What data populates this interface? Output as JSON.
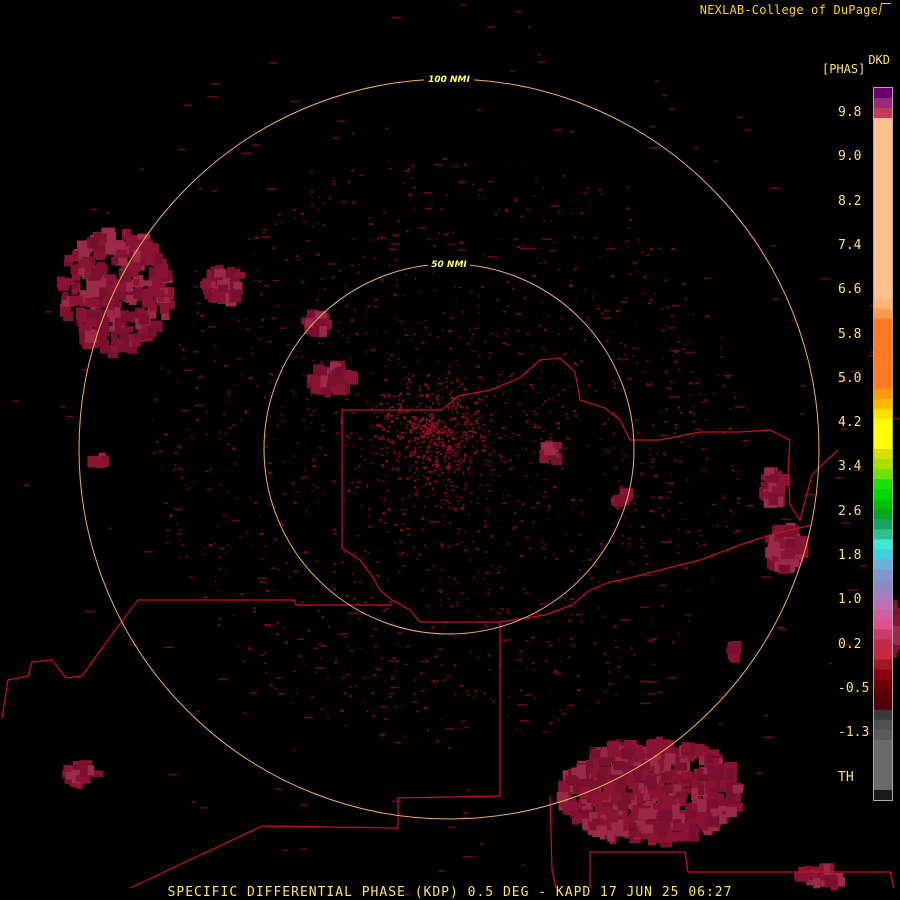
{
  "header": {
    "credit": "NEXLAB-College of DuPage",
    "product_code": "DKD",
    "units": "[PHAS]"
  },
  "footer": {
    "caption": "SPECIFIC DIFFERENTIAL PHASE (KDP) 0.5 DEG - KAPD 17 JUN 25 06:27"
  },
  "range_rings": [
    {
      "label": "50 NMI"
    },
    {
      "label": "100 NMI"
    }
  ],
  "legend": {
    "ticks": [
      "9.8",
      "9.0",
      "8.2",
      "7.4",
      "6.6",
      "5.8",
      "5.0",
      "4.2",
      "3.4",
      "2.6",
      "1.8",
      "1.0",
      "0.2",
      "-0.5",
      "-1.3",
      "TH"
    ],
    "colors": [
      "#6a006a",
      "#9a2a7a",
      "#c43a5a",
      "#ffc090",
      "#ffc090",
      "#ffc090",
      "#ffc090",
      "#ffc090",
      "#ffc090",
      "#ffc090",
      "#ffc090",
      "#ffc090",
      "#ffc090",
      "#ffc090",
      "#ffc090",
      "#ffc090",
      "#ffc090",
      "#ffc090",
      "#ffc090",
      "#ffc090",
      "#ffc090",
      "#ffb47a",
      "#ff9a50",
      "#ff7a20",
      "#ff7a20",
      "#ff7a20",
      "#ff7a20",
      "#ff7a20",
      "#ff7a20",
      "#ff7a20",
      "#ff9a10",
      "#ffb800",
      "#ffe000",
      "#ffff00",
      "#ffff00",
      "#ffff00",
      "#d8e000",
      "#a8e000",
      "#70e000",
      "#20e000",
      "#00d800",
      "#00c000",
      "#00a820",
      "#20a060",
      "#30c090",
      "#40e8d8",
      "#40d0e0",
      "#6ab0d8",
      "#7a9ad0",
      "#8a8ac0",
      "#a080c0",
      "#c070b0",
      "#d060a0",
      "#e0508a",
      "#c83a6a",
      "#c02a4a",
      "#c8283a",
      "#a01828",
      "#8a0010",
      "#700008",
      "#5a0008",
      "#500008",
      "#3a3a3a",
      "#505050",
      "#5a5a5a",
      "#6a6a6a",
      "#6a6a6a",
      "#6a6a6a",
      "#6a6a6a",
      "#6a6a6a",
      "#1a1a1a"
    ]
  }
}
